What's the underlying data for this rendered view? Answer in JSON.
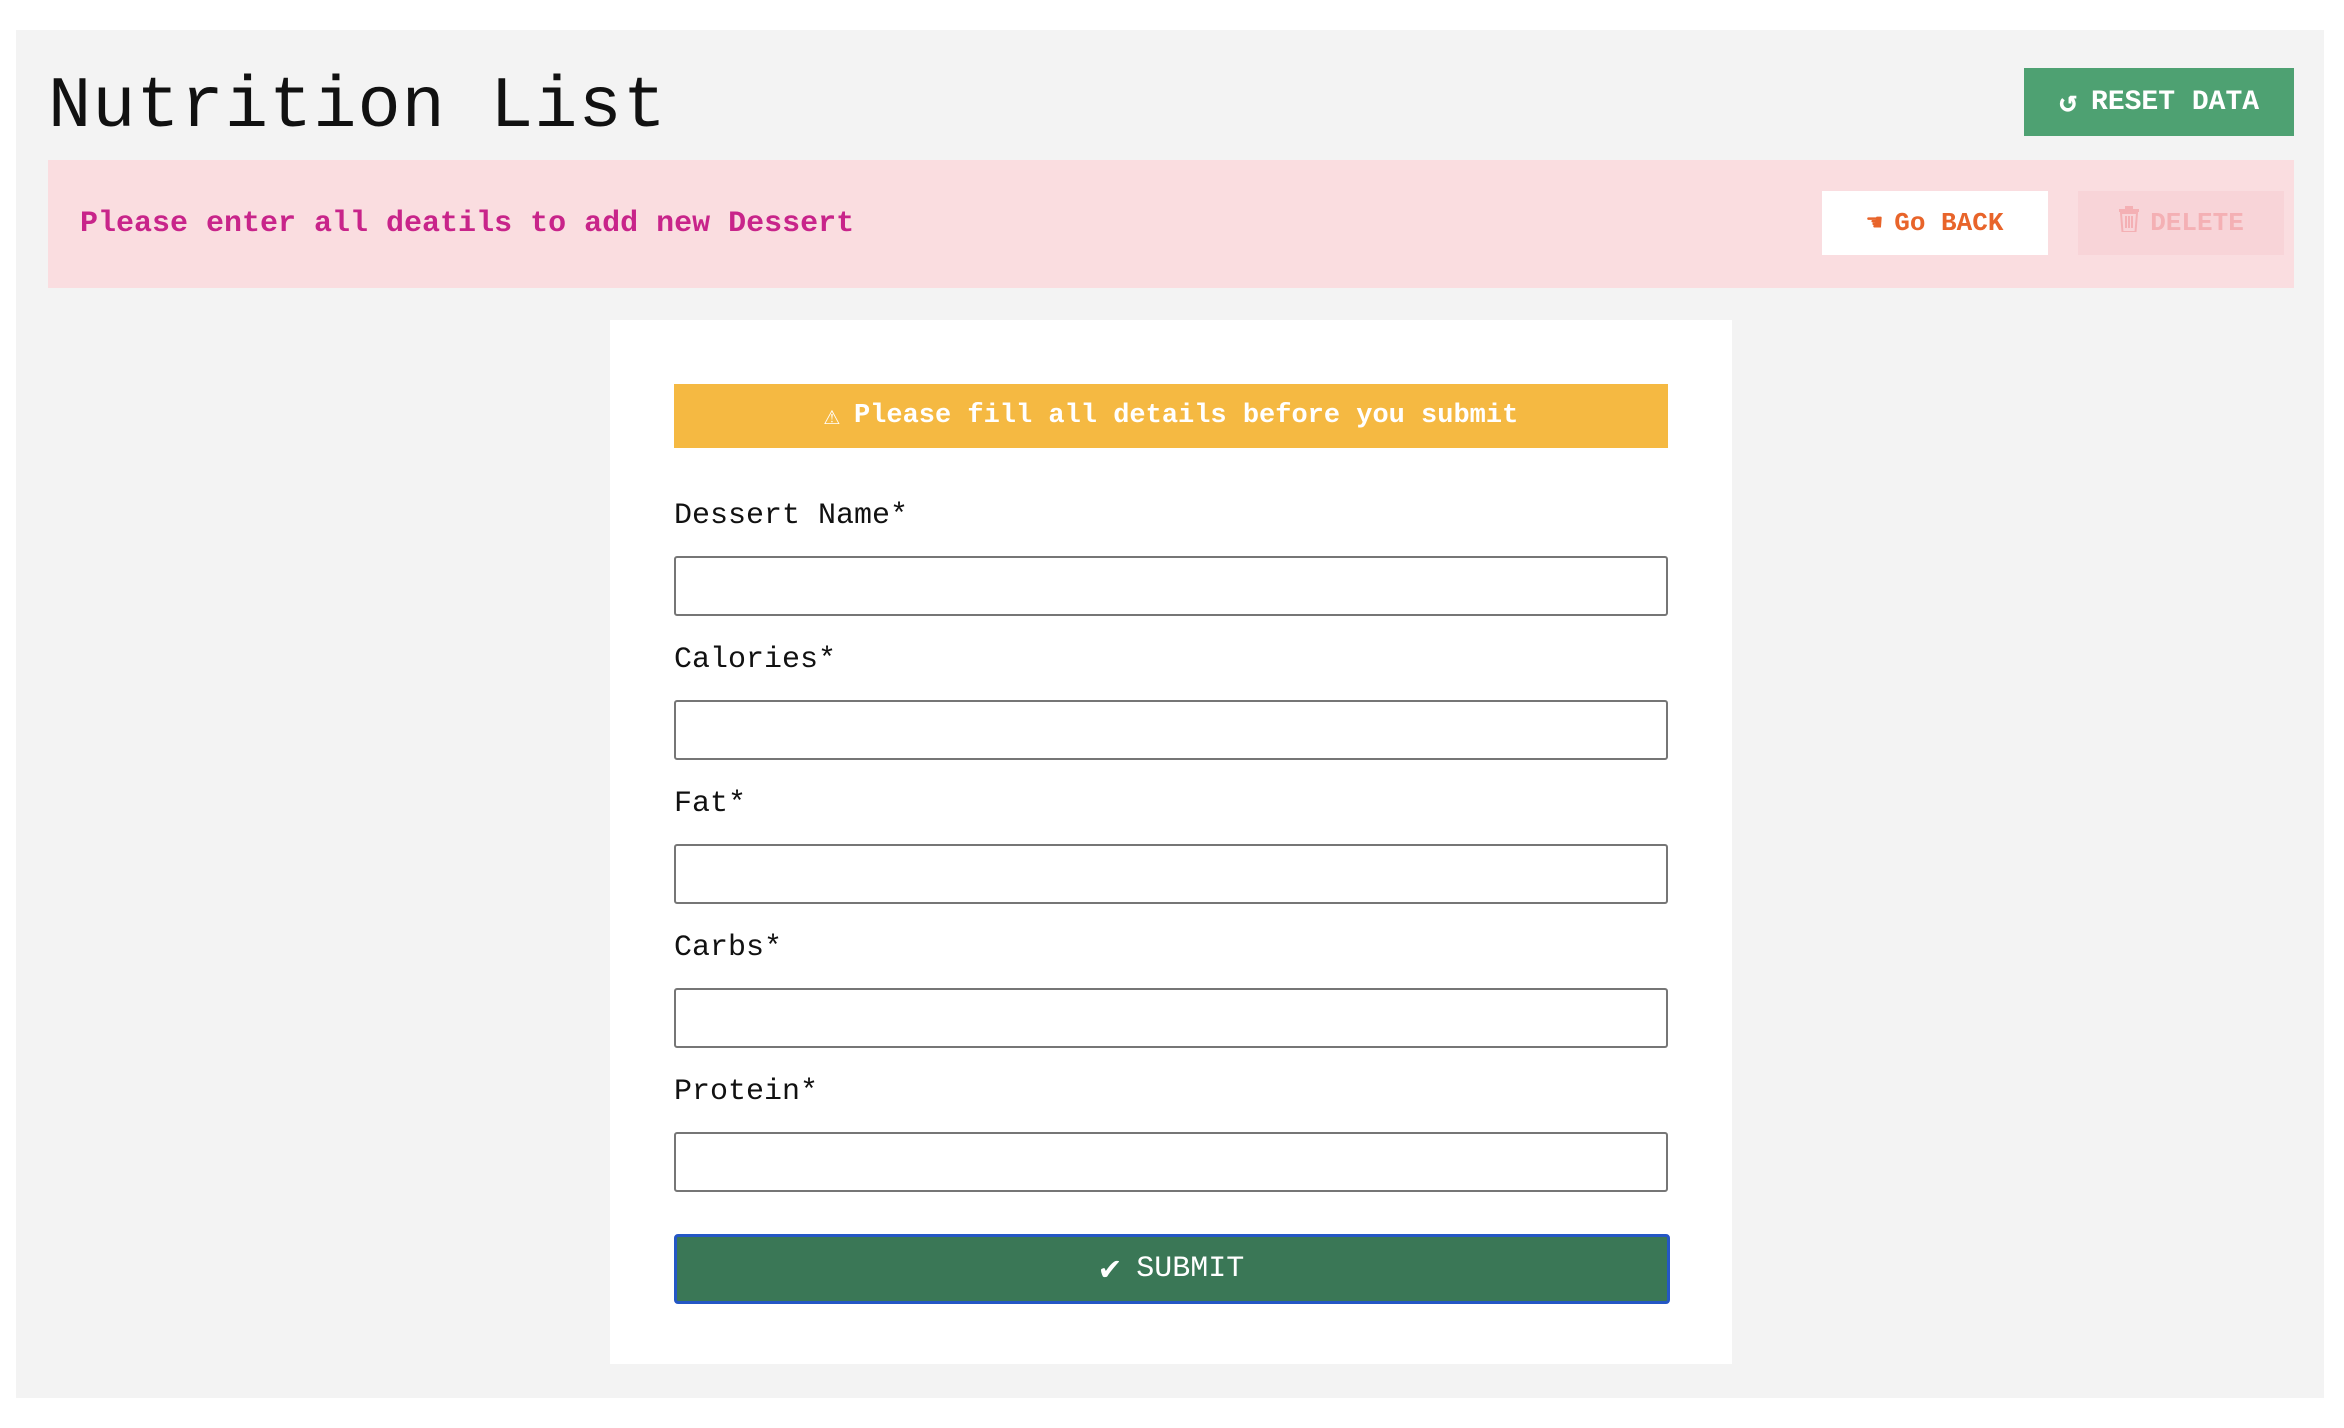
{
  "header": {
    "title": "Nutrition List",
    "reset_label": "RESET DATA",
    "reset_icon": "refresh-icon"
  },
  "banner": {
    "message": "Please enter all deatils to add new Dessert",
    "back_label": "Go BACK",
    "back_icon": "pointing-hand-icon",
    "delete_label": "DELETE",
    "delete_icon": "trash-icon"
  },
  "form": {
    "warning_icon": "warning-icon",
    "warning_text": "Please fill all details before you submit",
    "fields": [
      {
        "label": "Dessert Name*",
        "value": "",
        "placeholder": ""
      },
      {
        "label": "Calories*",
        "value": "",
        "placeholder": ""
      },
      {
        "label": "Fat*",
        "value": "",
        "placeholder": ""
      },
      {
        "label": "Carbs*",
        "value": "",
        "placeholder": ""
      },
      {
        "label": "Protein*",
        "value": "",
        "placeholder": ""
      }
    ],
    "submit_label": "SUBMIT",
    "submit_icon": "checkmark-icon"
  },
  "colors": {
    "reset_button": "#4ea172",
    "banner_background": "#fadde0",
    "banner_text": "#c8248a",
    "back_button_text": "#e8642a",
    "warning_background": "#f5b942",
    "submit_background": "#3a7756",
    "submit_focus_border": "#2457c5"
  }
}
